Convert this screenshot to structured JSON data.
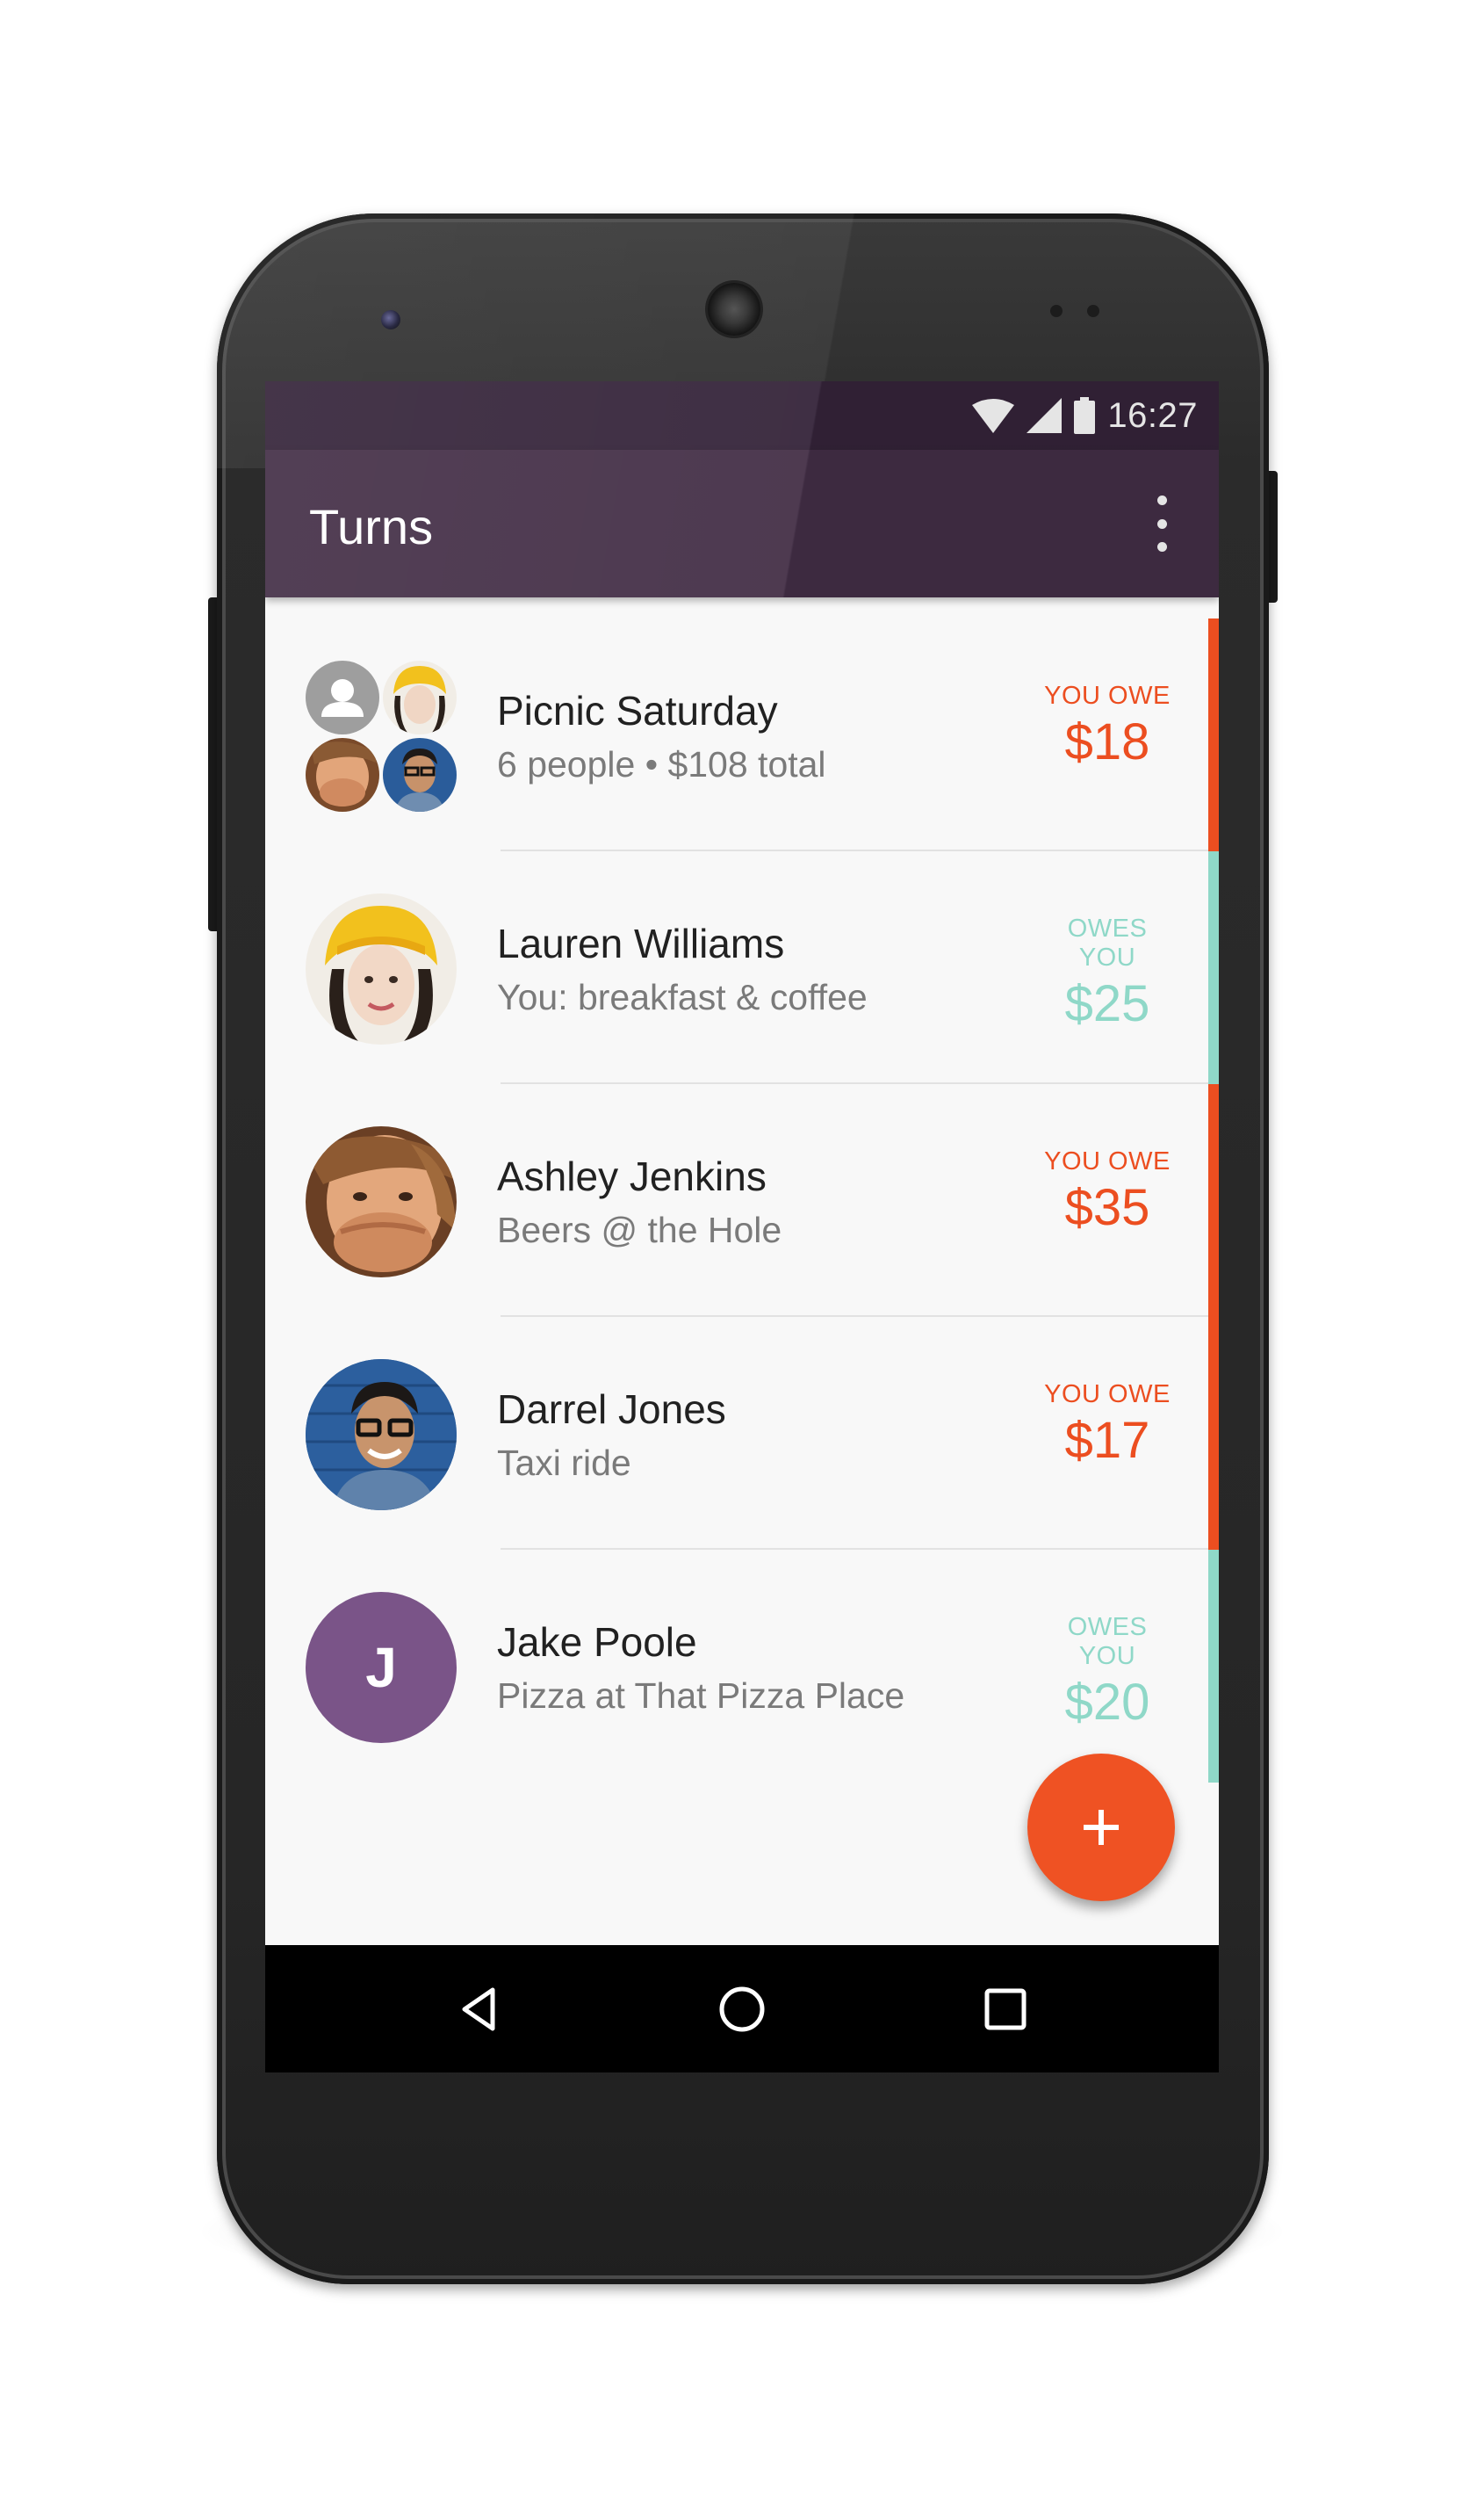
{
  "status_bar": {
    "time": "16:27"
  },
  "app_bar": {
    "title": "Turns"
  },
  "items": [
    {
      "name": "Picnic Saturday",
      "subtitle": "6 people • $108 total",
      "amount_label": "YOU OWE",
      "amount": "$18",
      "direction": "owe"
    },
    {
      "name": "Lauren Williams",
      "subtitle": "You: breakfast & coffee",
      "amount_label": "OWES YOU",
      "amount": "$25",
      "direction": "owed"
    },
    {
      "name": "Ashley Jenkins",
      "subtitle": "Beers @ the Hole",
      "amount_label": "YOU OWE",
      "amount": "$35",
      "direction": "owe"
    },
    {
      "name": "Darrel Jones",
      "subtitle": "Taxi ride",
      "amount_label": "YOU OWE",
      "amount": "$17",
      "direction": "owe"
    },
    {
      "name": "Jake Poole",
      "subtitle": "Pizza at That Pizza Place",
      "amount_label": "OWES YOU",
      "amount": "$20",
      "direction": "owed",
      "initial": "J"
    }
  ],
  "colors": {
    "status_bar": "#35243a",
    "app_bar": "#442f47",
    "owe": "#ec4e20",
    "owed": "#8fd8c8",
    "fab": "#ef5223",
    "jake_avatar": "#7a5488"
  },
  "icons": {
    "status": [
      "wifi-icon",
      "cell-signal-icon",
      "battery-icon"
    ],
    "app_bar": [
      "overflow-menu-icon"
    ],
    "fab": "plus-icon",
    "nav": [
      "back-icon",
      "home-icon",
      "recents-icon"
    ]
  }
}
